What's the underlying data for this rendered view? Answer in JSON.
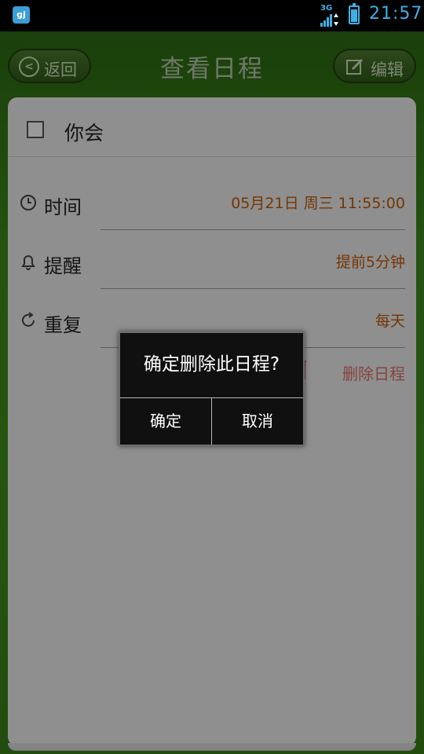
{
  "status_bar": {
    "app_icon_text": "gj",
    "network": "3G",
    "time": "21:57",
    "accent": "#3fb0e6"
  },
  "titlebar": {
    "back_label": "返回",
    "title": "查看日程",
    "edit_label": "编辑"
  },
  "event": {
    "title": "你会",
    "checked": false,
    "fields": [
      {
        "icon": "clock-icon",
        "label": "时间",
        "value": "05月21日 周三 11:55:00"
      },
      {
        "icon": "bell-icon",
        "label": "提醒",
        "value": "提前5分钟"
      },
      {
        "icon": "repeat-icon",
        "label": "重复",
        "value": "每天"
      }
    ],
    "delete_label": "删除日程",
    "value_color": "#c25a0a"
  },
  "dialog": {
    "message": "确定删除此日程?",
    "ok_label": "确定",
    "cancel_label": "取消"
  }
}
